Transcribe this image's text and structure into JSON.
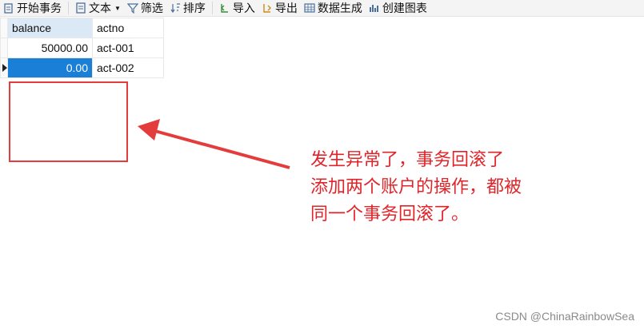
{
  "toolbar": {
    "begin_transaction": "开始事务",
    "text": "文本",
    "filter": "筛选",
    "sort": "排序",
    "import": "导入",
    "export": "导出",
    "generate_data": "数据生成",
    "create_chart": "创建图表"
  },
  "table": {
    "columns": [
      "balance",
      "actno"
    ],
    "rows": [
      {
        "balance": "50000.00",
        "actno": "act-001"
      },
      {
        "balance": "0.00",
        "actno": "act-002"
      }
    ]
  },
  "annotation": {
    "line1": "发生异常了，事务回滚了",
    "line2": "添加两个账户的操作，都被",
    "line3": "同一个事务回滚了。"
  },
  "watermark": "CSDN @ChinaRainbowSea",
  "colors": {
    "annotation": "#e0252a",
    "selection": "#1a7fd6"
  }
}
